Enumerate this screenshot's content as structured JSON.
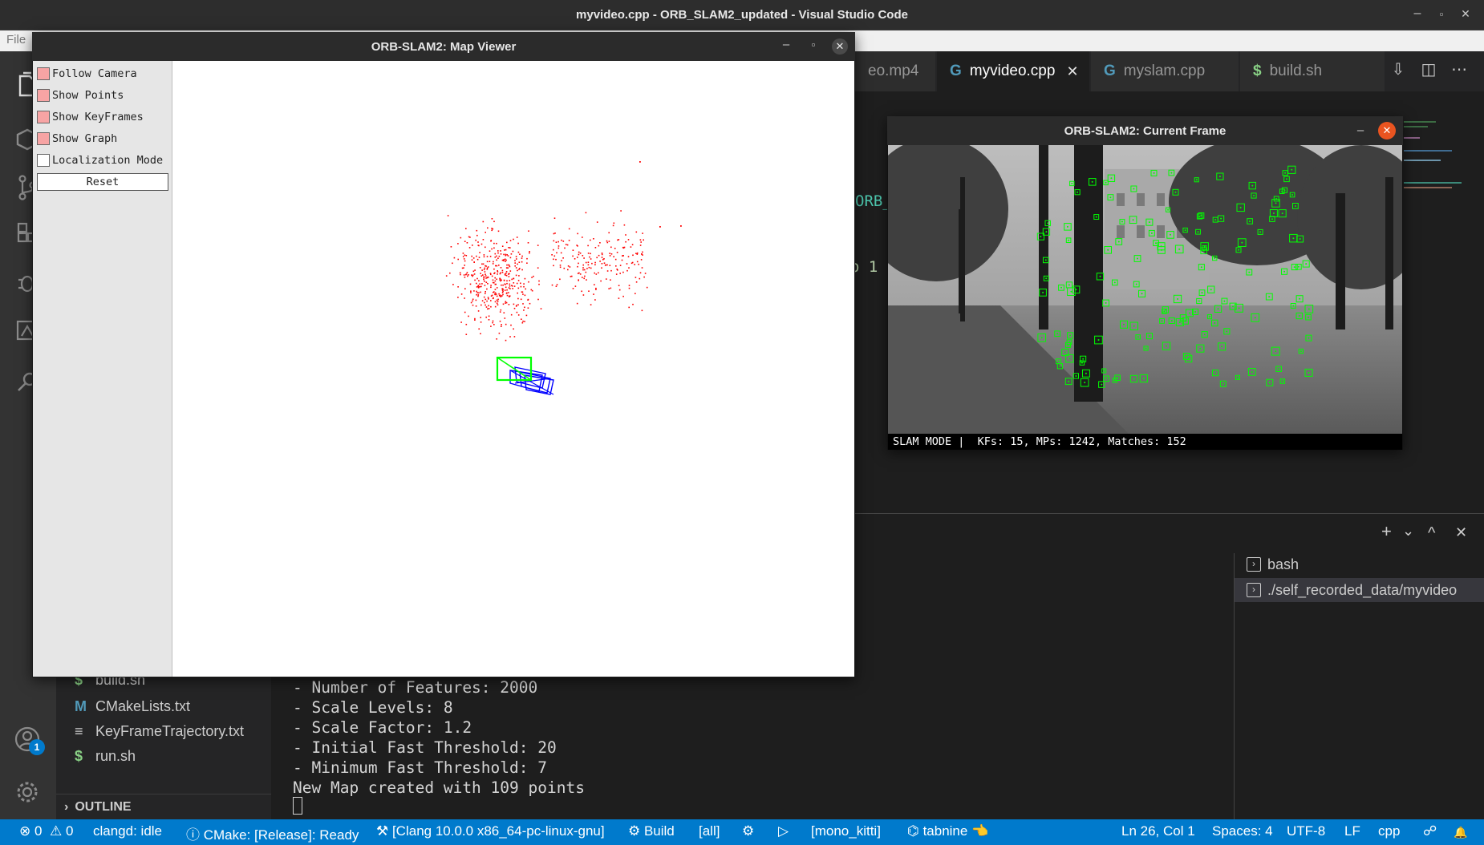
{
  "window": {
    "title": "myvideo.cpp - ORB_SLAM2_updated - Visual Studio Code",
    "minimize": "–",
    "maximize": "▫",
    "close": "✕"
  },
  "menu": {
    "file": "File"
  },
  "activity_bar": {
    "icons": [
      "files-icon",
      "extensions-icon",
      "source-control-icon",
      "remote-explorer-icon",
      "debug-icon",
      "cmake-icon",
      "search-icon"
    ],
    "accounts_badge": "1"
  },
  "sidebar": {
    "files": [
      {
        "icon": "$",
        "icon_color": "#89d185",
        "name": "build.sh"
      },
      {
        "icon": "M",
        "icon_color": "#519aba",
        "name": "CMakeLists.txt"
      },
      {
        "icon": "≡",
        "icon_color": "#cccccc",
        "name": "KeyFrameTrajectory.txt"
      },
      {
        "icon": "$",
        "icon_color": "#89d185",
        "name": "run.sh"
      }
    ],
    "outline_label": "OUTLINE",
    "outline_chevron": "›"
  },
  "editor": {
    "tabs": [
      {
        "label": "eo.mp4",
        "icon": "",
        "active": false
      },
      {
        "label": "myvideo.cpp",
        "icon": "G",
        "active": true,
        "close": "✕"
      },
      {
        "label": "myslam.cpp",
        "icon": "G",
        "active": false
      },
      {
        "label": "build.sh",
        "icon": "$",
        "active": false
      }
    ],
    "tools": [
      "⇩",
      "◫",
      "⋯"
    ],
    "code_fragments": {
      "orb": "ORB_",
      "one": "o 1"
    }
  },
  "terminal": {
    "lines": [
      "- Number of Features: 2000",
      "- Scale Levels: 8",
      "- Scale Factor: 1.2",
      "- Initial Fast Threshold: 20",
      "- Minimum Fast Threshold: 7",
      "New Map created with 109 points"
    ],
    "sessions": [
      {
        "label": "bash",
        "active": false
      },
      {
        "label": "./self_recorded_data/myvideo",
        "active": true
      }
    ],
    "panel_buttons": {
      "add": "+",
      "dropdown": "⌄",
      "maximize": "^",
      "close": "✕"
    }
  },
  "status_bar": {
    "errors": "⊗ 0",
    "warnings": "⚠ 0",
    "clangd": "clangd: idle",
    "cmake": "ⓘ CMake: [Release]: Ready",
    "kit": "⚒ [Clang 10.0.0 x86_64-pc-linux-gnu]",
    "build": "⚙ Build",
    "target": "[all]",
    "debug": "⚙",
    "run": "▷",
    "launch": "[mono_kitti]",
    "tabnine": "⌬ tabnine 👈",
    "position": "Ln 26, Col 1",
    "spaces": "Spaces: 4",
    "encoding": "UTF-8",
    "eol": "LF",
    "language": "cpp",
    "feedback": "☍",
    "bell": "🔔"
  },
  "map_viewer": {
    "title": "ORB-SLAM2: Map Viewer",
    "controls": [
      {
        "label": "Follow Camera",
        "checked": true
      },
      {
        "label": "Show Points",
        "checked": true
      },
      {
        "label": "Show KeyFrames",
        "checked": true
      },
      {
        "label": "Show Graph",
        "checked": true
      },
      {
        "label": "Localization Mode",
        "checked": false
      }
    ],
    "reset_label": "Reset",
    "point_color": "#ff0000",
    "keyframe_color": "#0000ff",
    "current_camera_color": "#00ff00"
  },
  "current_frame": {
    "title": "ORB-SLAM2: Current Frame",
    "status": "SLAM MODE |  KFs: 15, MPs: 1242, Matches: 152",
    "feature_color": "#00ff00"
  }
}
